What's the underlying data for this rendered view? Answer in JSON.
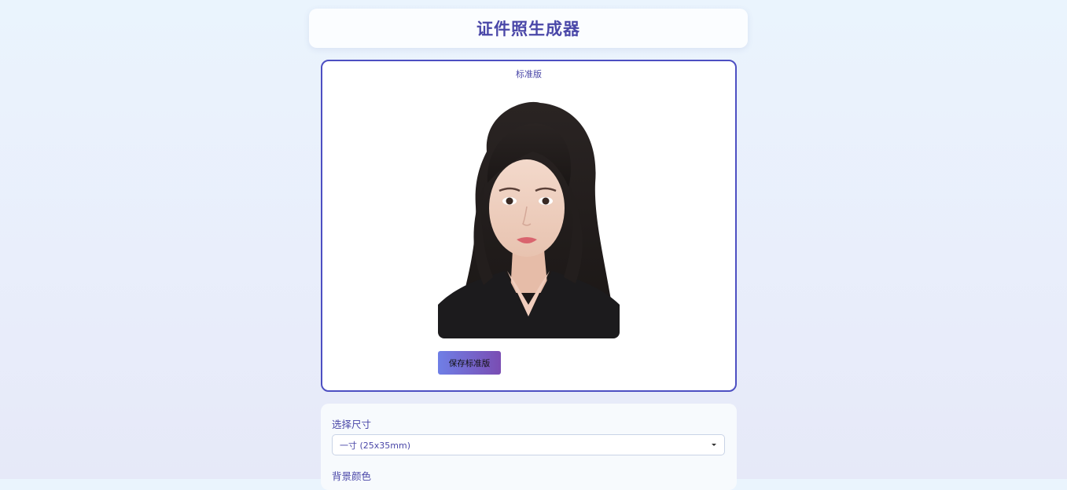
{
  "header": {
    "title": "证件照生成器"
  },
  "preview": {
    "label": "标准版",
    "save_button": "保存标准版",
    "photo_image": "portrait-photo"
  },
  "settings": {
    "size_label": "选择尺寸",
    "size_value": "一寸 (25x35mm)",
    "bg_label": "背景颜色"
  },
  "colors": {
    "accent": "#4a47a8",
    "card_border": "#4d4fc2",
    "button_gradient_start": "#6f7fe6",
    "button_gradient_end": "#7a4db3"
  }
}
